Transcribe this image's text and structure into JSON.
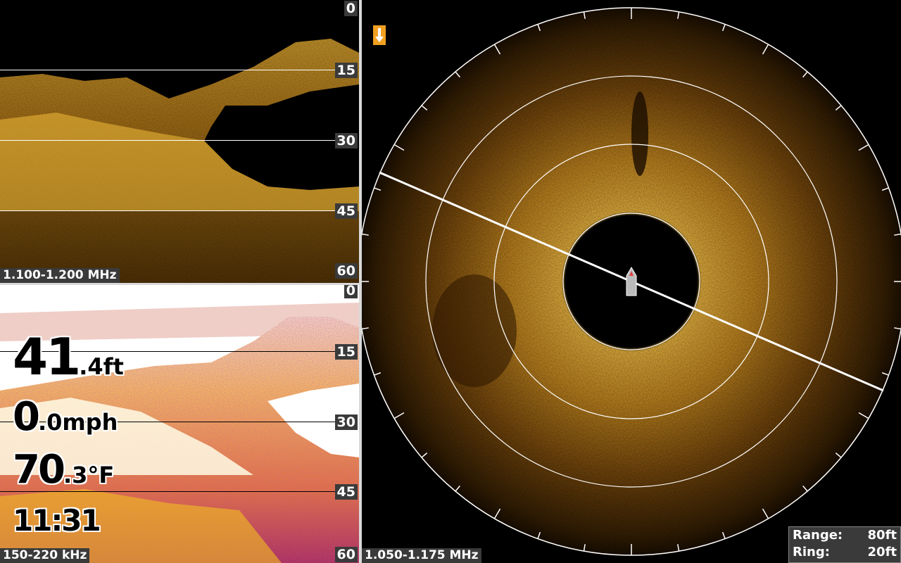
{
  "down_imaging": {
    "depth_ticks": [
      "0",
      "15",
      "30",
      "45",
      "60"
    ],
    "frequency": "1.100-1.200 MHz"
  },
  "sonar_2d": {
    "depth_ticks": [
      "0",
      "15",
      "30",
      "45",
      "60"
    ],
    "frequency": "150-220 kHz",
    "depth": {
      "whole": "41",
      "decimal": ".4",
      "unit": "ft"
    },
    "speed": {
      "whole": "0",
      "decimal": ".0",
      "unit": "mph"
    },
    "temperature": {
      "whole": "70",
      "decimal": ".3",
      "unit": "°F"
    },
    "time": "11:31"
  },
  "sonar_360": {
    "frequency": "1.050-1.175 MHz",
    "range_label": "Range:",
    "range_value": "80ft",
    "ring_label": "Ring:",
    "ring_value": "20ft",
    "marker_icon": "arrow-down-icon",
    "boat_icon": "boat-icon"
  },
  "colors": {
    "amber": "#e0a020",
    "dark_amber": "#3a2200",
    "ui_gray": "#3a3a3a"
  }
}
